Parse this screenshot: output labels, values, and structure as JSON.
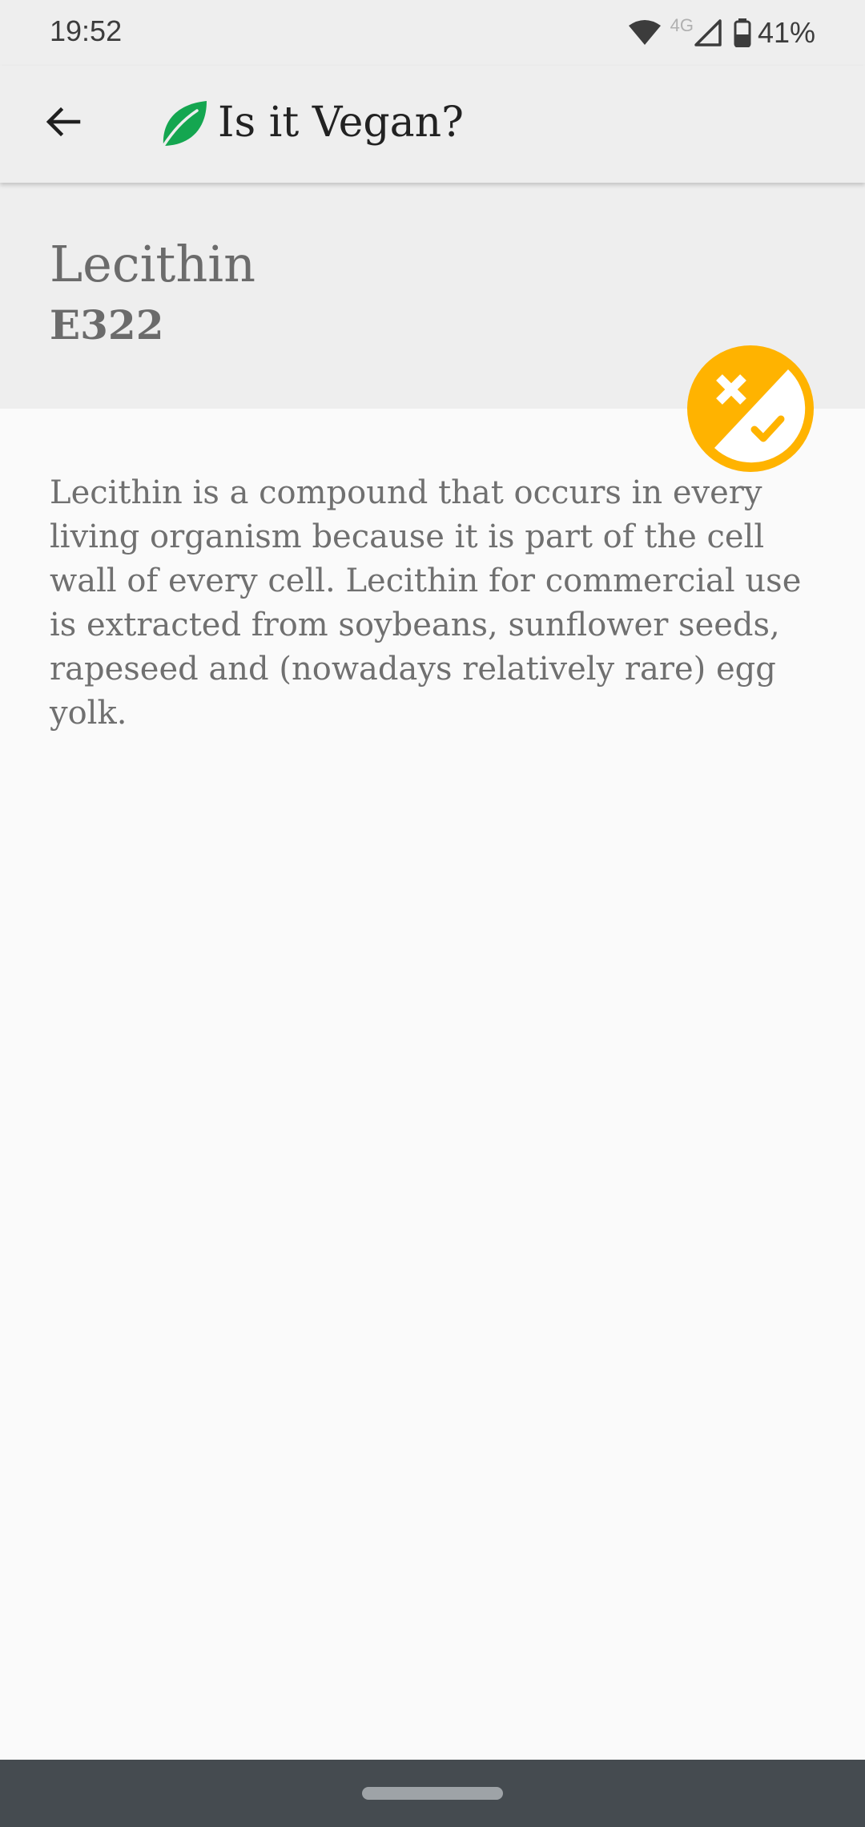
{
  "status_bar": {
    "time": "19:52",
    "network_type": "4G",
    "battery_percent": "41%",
    "icons": [
      "wifi-icon",
      "cell-signal-icon",
      "battery-icon"
    ]
  },
  "app_bar": {
    "title": "Is it Vegan?",
    "back_icon": "arrow-back-icon",
    "logo_icon": "leaf-icon",
    "logo_color": "#14a650"
  },
  "ingredient": {
    "name": "Lecithin",
    "code": "E322",
    "description": "Lecithin is a compound that occurs in every living organism because it is part of the cell wall of every cell. Lecithin for commercial use is extracted from soybeans, sunflower seeds, rapeseed and (nowadays relatively rare) egg yolk.",
    "status_icon": "maybe-vegan-icon",
    "status_color": "#ffb300"
  },
  "colors": {
    "surface": "#eeeeee",
    "background": "#fafafa",
    "nav_bar": "#454b50"
  }
}
